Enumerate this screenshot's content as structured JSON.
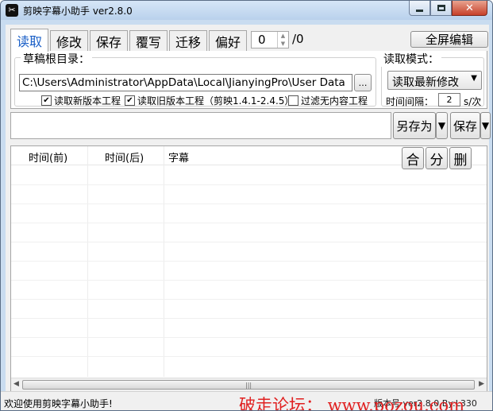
{
  "window": {
    "title": "剪映字幕小助手 ver2.8.0",
    "icon": "capcut-logo-icon"
  },
  "tabs": [
    {
      "label": "读取",
      "active": true
    },
    {
      "label": "修改"
    },
    {
      "label": "保存"
    },
    {
      "label": "覆写"
    },
    {
      "label": "迁移"
    },
    {
      "label": "偏好"
    }
  ],
  "page_counter": {
    "current": "0",
    "total": "/0"
  },
  "fullscreen_label": "全屏编辑",
  "drafts": {
    "group_title": "草稿根目录：",
    "path_value": "C:\\Users\\Administrator\\AppData\\Local\\JianyingPro\\User Data",
    "browse_label": "…",
    "options": [
      {
        "label": "读取新版本工程",
        "checked": true
      },
      {
        "label": "读取旧版本工程（剪映1.4.1-2.4.5）",
        "checked": true
      },
      {
        "label": "过滤无内容工程",
        "checked": false
      }
    ]
  },
  "read_mode": {
    "group_title": "读取模式：",
    "selected": "读取最新修改",
    "interval_label": "时间间隔：",
    "interval_value": "2",
    "interval_unit": "s/次"
  },
  "actions": {
    "saveas_label": "另存为",
    "save_label": "保存",
    "merge_label": "合",
    "split_label": "分",
    "delete_label": "删"
  },
  "table": {
    "columns": [
      "时间(前)",
      "时间(后)",
      "字幕"
    ],
    "rows": []
  },
  "statusbar": {
    "message": "欢迎使用剪映字幕小助手!",
    "version": "版本号 ver2.8.0 By:L330"
  },
  "watermark": "破走论坛： www.pozou.com"
}
